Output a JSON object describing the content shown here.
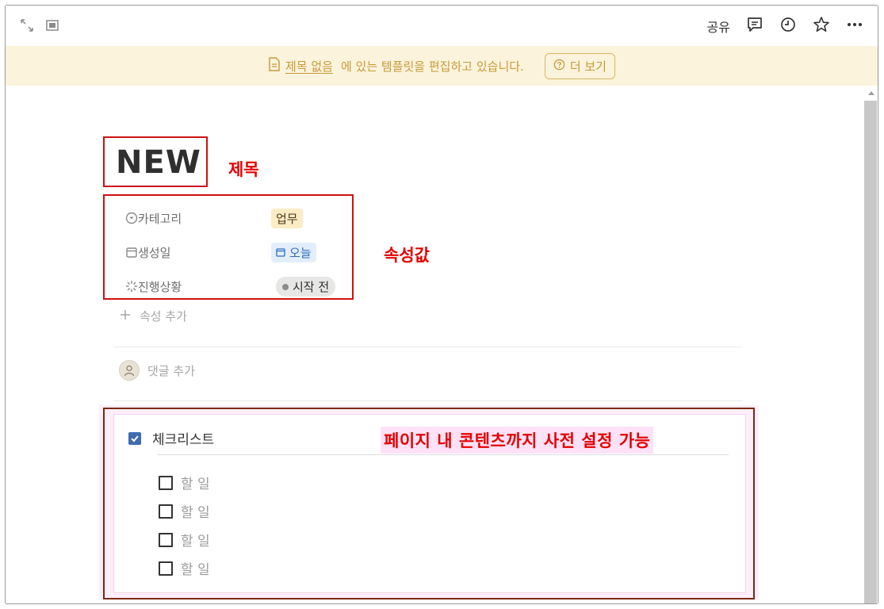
{
  "topbar": {
    "share_label": "공유",
    "icons": [
      "expand-icon",
      "sidebar-peek-icon",
      "comment-icon",
      "clock-icon",
      "star-icon",
      "more-icon"
    ]
  },
  "banner": {
    "page_link": "제목 없음",
    "message": "에 있는 템플릿을 편집하고 있습니다.",
    "more_label": "더 보기"
  },
  "page": {
    "title": "NEW",
    "properties": [
      {
        "name": "카테고리",
        "value": "업무",
        "icon": "select-icon",
        "style": "yellow-tag"
      },
      {
        "name": "생성일",
        "value": "오늘",
        "icon": "calendar-icon",
        "style": "blue-tag"
      },
      {
        "name": "진행상황",
        "value": "시작 전",
        "icon": "status-icon",
        "style": "gray-pill"
      }
    ],
    "add_property": "속성 추가",
    "add_comment": "댓글 추가",
    "checklist": {
      "title": "체크리스트",
      "items": [
        "할 일",
        "할 일",
        "할 일",
        "할 일"
      ]
    }
  },
  "annotations": {
    "title_note": "제목",
    "props_note": "속성값",
    "content_note": "페이지 내 콘텐츠까지 사전 설정 가능"
  },
  "colors": {
    "annotation_red": "#e50000",
    "banner_bg": "#fbf3db",
    "banner_text": "#c79a3a",
    "checkbox_blue": "#3f6bb0"
  }
}
